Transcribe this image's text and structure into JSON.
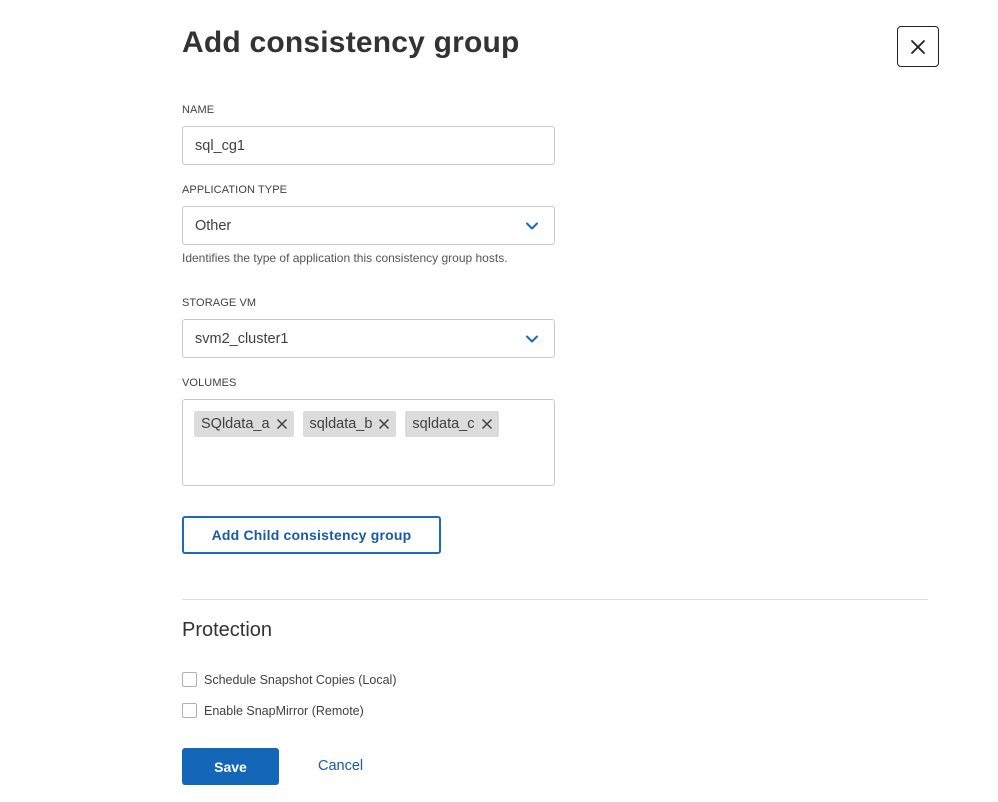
{
  "dialog": {
    "title": "Add consistency group",
    "close_icon": "close-icon"
  },
  "form": {
    "name": {
      "label": "NAME",
      "value": "sql_cg1"
    },
    "application_type": {
      "label": "APPLICATION TYPE",
      "value": "Other",
      "helper": "Identifies the type of application this consistency group hosts."
    },
    "storage_vm": {
      "label": "STORAGE VM",
      "value": "svm2_cluster1"
    },
    "volumes": {
      "label": "VOLUMES",
      "chips": [
        "SQldata_a",
        "sqldata_b",
        "sqldata_c"
      ]
    },
    "add_child_label": "Add Child consistency group"
  },
  "protection": {
    "title": "Protection",
    "options": [
      {
        "label": "Schedule Snapshot Copies (Local)",
        "checked": false
      },
      {
        "label": "Enable SnapMirror (Remote)",
        "checked": false
      }
    ]
  },
  "actions": {
    "save_label": "Save",
    "cancel_label": "Cancel"
  },
  "colors": {
    "accent": "#1467b8",
    "link": "#1a5aa0",
    "border": "#c9c9c9",
    "chip_bg": "#dcdcdc"
  }
}
